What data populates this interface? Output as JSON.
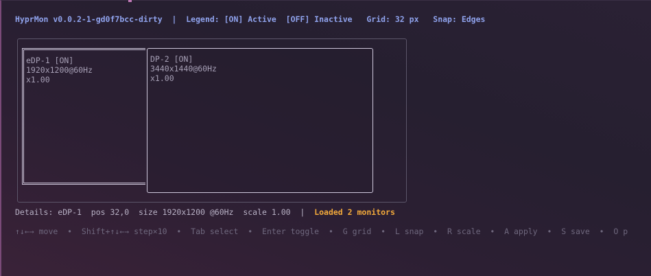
{
  "header": {
    "text": "HyprMon v0.0.2-1-gd0f7bcc-dirty  |  Legend: [ON] Active  [OFF] Inactive   Grid: 32 px   Snap: Edges"
  },
  "monitors": [
    {
      "name_line": "eDP-1 [ON]",
      "mode_line": "1920x1200@60Hz",
      "scale_line": "x1.00"
    },
    {
      "name_line": "DP-2 [ON]",
      "mode_line": "3440x1440@60Hz",
      "scale_line": "x1.00"
    }
  ],
  "details": {
    "text": "Details: eDP-1  pos 32,0  size 1920x1200 @60Hz  scale 1.00  |  ",
    "status": "Loaded 2 monitors"
  },
  "help": {
    "text": "↑↓←→ move  •  Shift+↑↓←→ step×10  •  Tab select  •  Enter toggle  •  G grid  •  L snap  •  R scale  •  A apply  •  S save  •  O p"
  },
  "colors": {
    "accent": "#8fa2ec",
    "status": "#f2a93b",
    "border": "#cfc8dc"
  }
}
